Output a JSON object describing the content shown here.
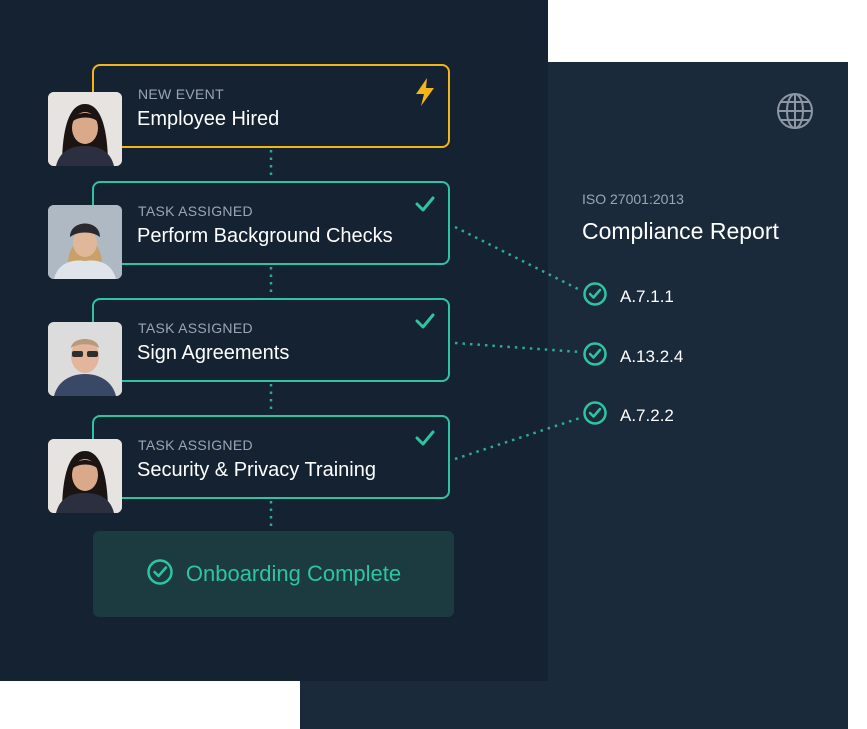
{
  "workflow": {
    "steps": [
      {
        "label": "NEW EVENT",
        "title": "Employee Hired",
        "icon": "lightning-icon"
      },
      {
        "label": "TASK ASSIGNED",
        "title": "Perform Background Checks",
        "icon": "check-icon"
      },
      {
        "label": "TASK ASSIGNED",
        "title": "Sign Agreements",
        "icon": "check-icon"
      },
      {
        "label": "TASK ASSIGNED",
        "title": "Security & Privacy Training",
        "icon": "check-icon"
      }
    ],
    "complete_label": "Onboarding Complete"
  },
  "compliance": {
    "standard": "ISO 27001:2013",
    "title": "Compliance Report",
    "controls": [
      "A.7.1.1",
      "A.13.2.4",
      "A.7.2.2"
    ]
  },
  "colors": {
    "accent_green": "#2fc4a0",
    "event_yellow": "#f3b51b",
    "panel_dark": "#152231",
    "panel_secondary": "#1b2a3b",
    "complete_bg": "#1b3b40"
  }
}
